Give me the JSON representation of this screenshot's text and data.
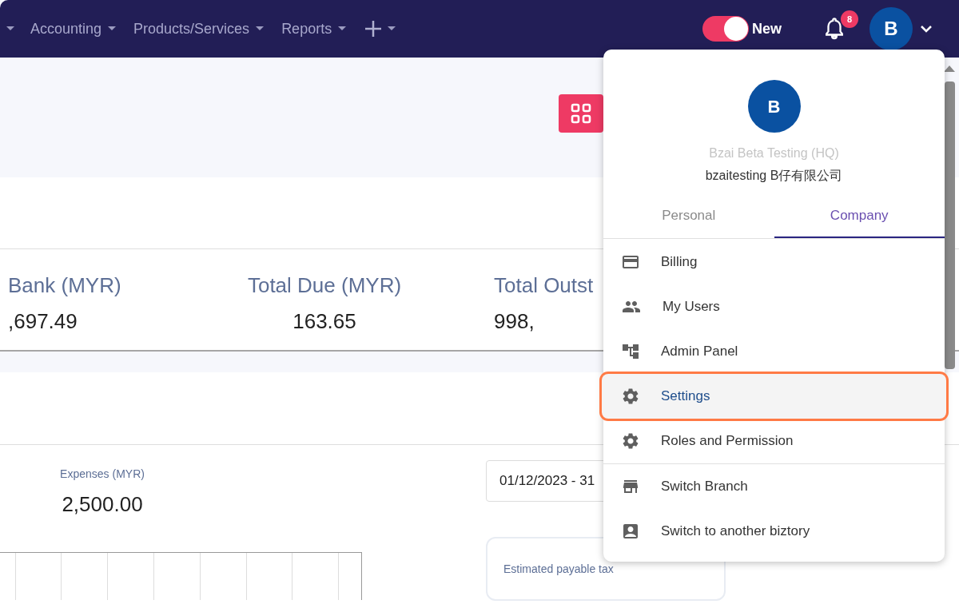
{
  "nav": {
    "items": [
      {
        "label": "Accounting"
      },
      {
        "label": "Products/Services"
      },
      {
        "label": "Reports"
      }
    ],
    "toggle": {
      "label": "New",
      "on": true
    },
    "notifications": {
      "count": "8"
    },
    "avatar": "B"
  },
  "stats": [
    {
      "label": "Bank (MYR)",
      "value": ",697.49"
    },
    {
      "label": "Total Due (MYR)",
      "value": "163.65"
    },
    {
      "label": "Total Outst",
      "value": "998,"
    }
  ],
  "expenses": {
    "label": "Expenses (MYR)",
    "value": "2,500.00"
  },
  "date_range": {
    "value": "01/12/2023 - 31"
  },
  "tax_card": {
    "label": "Estimated payable tax"
  },
  "account_menu": {
    "avatar": "B",
    "branch": "Bzai Beta Testing (HQ)",
    "company": "bzaitesting B仔有限公司",
    "tabs": [
      {
        "label": "Personal",
        "selected": false
      },
      {
        "label": "Company",
        "selected": true
      }
    ],
    "items": [
      {
        "kind": "card",
        "label": "Billing",
        "selected": false,
        "divider": false
      },
      {
        "kind": "users",
        "label": "My Users",
        "selected": false,
        "divider": false
      },
      {
        "kind": "tree",
        "label": "Admin Panel",
        "selected": false,
        "divider": false
      },
      {
        "kind": "gear",
        "label": "Settings",
        "selected": true,
        "divider": false
      },
      {
        "kind": "gear",
        "label": "Roles and Permission",
        "selected": false,
        "divider": false
      },
      {
        "kind": "store",
        "label": "Switch Branch",
        "selected": false,
        "divider": true
      },
      {
        "kind": "contact",
        "label": "Switch to another biztory",
        "selected": false,
        "divider": false
      }
    ]
  }
}
